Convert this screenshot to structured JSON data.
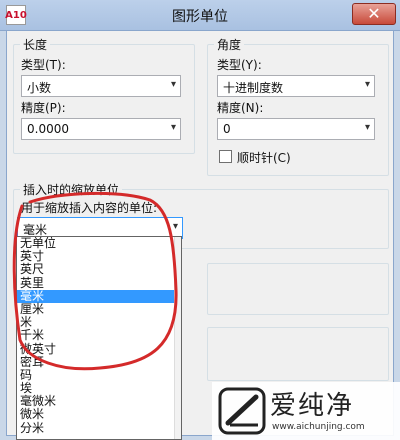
{
  "window": {
    "title": "图形单位",
    "icon_text": "A10",
    "close_glyph": "✕"
  },
  "length": {
    "group_label": "长度",
    "type_label": "类型(T):",
    "type_value": "小数",
    "precision_label": "精度(P):",
    "precision_value": "0.0000"
  },
  "angle": {
    "group_label": "角度",
    "type_label": "类型(Y):",
    "type_value": "十进制度数",
    "precision_label": "精度(N):",
    "precision_value": "0",
    "clockwise_label": "顺时针(C)"
  },
  "insertion": {
    "group_label": "插入时的缩放单位",
    "units_label": "用于缩放插入内容的单位:",
    "selected_value": "毫米",
    "options": [
      "无单位",
      "英寸",
      "英尺",
      "英里",
      "毫米",
      "厘米",
      "米",
      "千米",
      "微英寸",
      "密耳",
      "码",
      "埃",
      "毫微米",
      "微米",
      "分米"
    ],
    "selected_index": 4
  },
  "watermark": {
    "name": "爱纯净",
    "url": "www.aichunjing.com"
  },
  "colors": {
    "highlight": "#3399ff",
    "annotation": "#d42a2a",
    "titlebar": "#bcd0ea"
  },
  "icons": {
    "close": "close-icon",
    "dropdown": "chevron-down-icon"
  }
}
